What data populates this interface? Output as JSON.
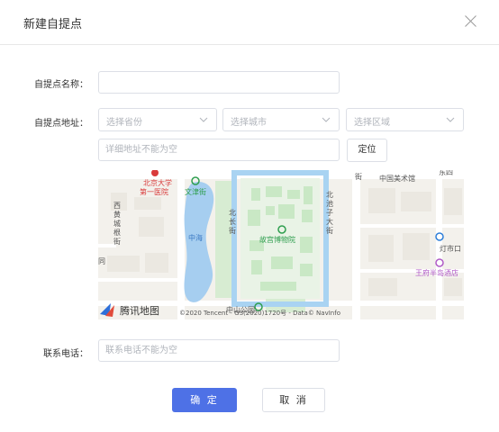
{
  "dialog": {
    "title": "新建自提点",
    "close_icon": "close-icon"
  },
  "form": {
    "name_label": "自提点名称：",
    "name_value": "",
    "address_label": "自提点地址：",
    "province_placeholder": "选择省份",
    "city_placeholder": "选择城市",
    "district_placeholder": "选择区域",
    "detail_placeholder": "详细地址不能为空",
    "locate_label": "定位",
    "phone_label": "联系电话：",
    "phone_placeholder": "联系电话不能为空"
  },
  "map": {
    "pois": {
      "art_museum": "中国美术馆",
      "peking_univ_hospital_1": "北京大学",
      "peking_univ_hospital_2": "第一医院",
      "wenjin": "文津街",
      "zhonghai": "中海",
      "palace_museum": "故宫博物院",
      "xihuangchenggen_1": "西",
      "xihuangchenggen_2": "黄",
      "xihuangchenggen_3": "城",
      "xihuangchenggen_4": "根",
      "xihuangchenggen_5": "街",
      "beichang_1": "北",
      "beichang_2": "长",
      "beichang_3": "街",
      "beichizi_1": "北",
      "beichizi_2": "池",
      "beichizi_3": "子",
      "beichizi_4": "大",
      "beichizi_5": "街",
      "dengshikou": "灯市口",
      "peninsula": "王府半岛酒店",
      "zhongshan_park": "中山公园",
      "top_right": "东四",
      "hutong_left": "同",
      "street_label": "街"
    },
    "logo_text": "腾讯地图",
    "copyright": "©2020 Tencent - GS(2020)1720号 - Data© NavInfo"
  },
  "footer": {
    "ok_label": "确 定",
    "cancel_label": "取 消"
  },
  "colors": {
    "primary": "#4e71e6",
    "border": "#dcdfe6",
    "placeholder": "#b0b4bb",
    "palace_wall": "#a9d3f2",
    "water": "#a6cef0",
    "park": "#c9e8c5",
    "poi_red": "#d93b3b",
    "poi_green": "#2e9e4e",
    "poi_purple": "#b05ac7"
  }
}
